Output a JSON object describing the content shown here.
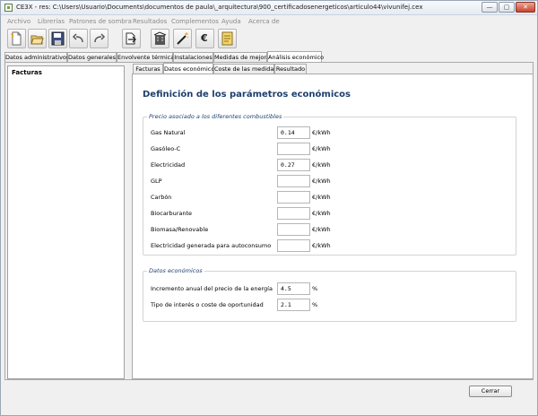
{
  "window": {
    "title": "CE3X - res: C:\\Users\\Usuario\\Documents\\documentos de paula\\_arquitectura\\900_certificadosenergeticos\\articulo44\\vivunifej.cex",
    "min_label": "—",
    "max_label": "▢",
    "close_label": "✕"
  },
  "menu": {
    "items": [
      "Archivo",
      "Librerías",
      "Patrones de sombra",
      "Resultados",
      "Complementos",
      "Ayuda",
      "Acerca de"
    ]
  },
  "toolbar": {
    "icons": [
      "new-document-icon",
      "open-folder-icon",
      "save-disk-icon",
      "undo-icon",
      "redo-icon",
      "import-icon",
      "building-icon",
      "magic-wand-icon",
      "euro-icon",
      "notes-icon"
    ],
    "euro_symbol": "€"
  },
  "main_tabs": [
    "Datos administrativos",
    "Datos generales",
    "Envolvente térmica",
    "Instalaciones",
    "Medidas de mejora",
    "Análisis económico"
  ],
  "left_panel": {
    "title": "Facturas"
  },
  "sub_tabs": [
    "Facturas",
    "Datos económicos",
    "Coste de las medidas",
    "Resultado"
  ],
  "section_title": "Definición de los parámetros económicos",
  "fuel_group": {
    "legend": "Precio asociado a los diferentes combustibles",
    "rows": [
      {
        "label": "Gas Natural",
        "value": "0.14",
        "unit": "€/kWh"
      },
      {
        "label": "Gasóleo-C",
        "value": "",
        "unit": "€/kWh"
      },
      {
        "label": "Electricidad",
        "value": "0.27",
        "unit": "€/kWh"
      },
      {
        "label": "GLP",
        "value": "",
        "unit": "€/kWh"
      },
      {
        "label": "Carbón",
        "value": "",
        "unit": "€/kWh"
      },
      {
        "label": "Biocarburante",
        "value": "",
        "unit": "€/kWh"
      },
      {
        "label": "Biomasa/Renovable",
        "value": "",
        "unit": "€/kWh"
      },
      {
        "label": "Electricidad generada para autoconsumo",
        "value": "",
        "unit": "€/kWh"
      }
    ]
  },
  "econ_group": {
    "legend": "Datos económicos",
    "rows": [
      {
        "label": "Incremento anual del precio de la energía",
        "value": "4.5",
        "unit": "%"
      },
      {
        "label": "Tipo de interés o coste de oportunidad",
        "value": "2.1",
        "unit": "%"
      }
    ]
  },
  "footer": {
    "close_button": "Cerrar"
  },
  "colors": {
    "heading": "#1d3f6e",
    "menu_text": "#8a8a8a"
  }
}
